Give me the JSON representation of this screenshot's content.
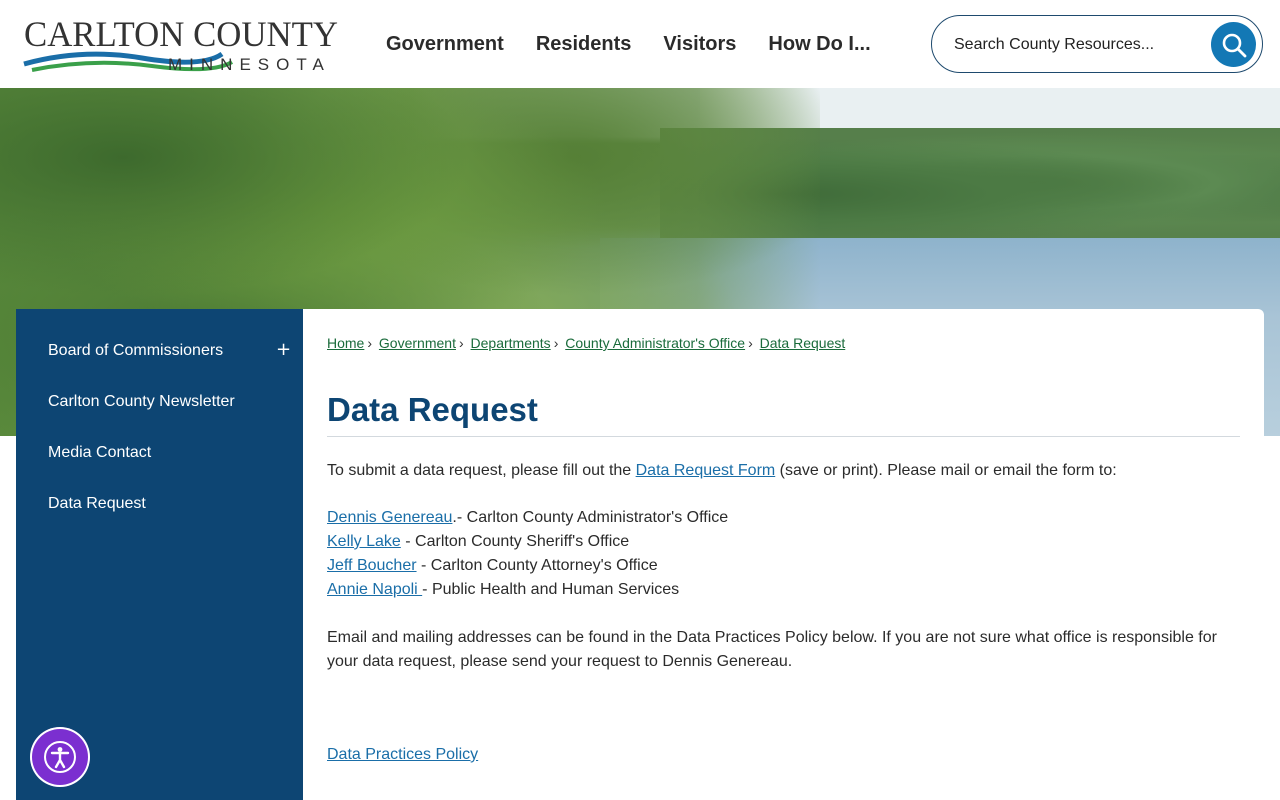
{
  "header": {
    "logo": {
      "line1": "CARLTON COUNTY",
      "line2": "MINNESOTA"
    },
    "nav": [
      {
        "label": "Government"
      },
      {
        "label": "Residents"
      },
      {
        "label": "Visitors"
      },
      {
        "label": "How Do I..."
      }
    ],
    "search": {
      "placeholder": "Search County Resources...",
      "icon": "search-icon"
    }
  },
  "sidebar": {
    "items": [
      {
        "label": "Board of Commissioners",
        "expand": "+"
      },
      {
        "label": "Carlton County Newsletter"
      },
      {
        "label": "Media Contact"
      },
      {
        "label": "Data Request"
      }
    ]
  },
  "breadcrumb": {
    "items": [
      "Home",
      "Government",
      "Departments",
      "County Administrator's Office",
      "Data Request"
    ],
    "separator": "›"
  },
  "main": {
    "title": "Data Request",
    "intro_before": "To submit a data request, please fill out the ",
    "intro_link": "Data Request Form",
    "intro_after": " (save or print). Please mail or email the form to:",
    "contacts": [
      {
        "name": "Dennis Genereau",
        "suffix": ".- Carlton County Administrator's Office"
      },
      {
        "name": "Kelly Lake",
        "suffix": " - Carlton County Sheriff's Office"
      },
      {
        "name": "Jeff Boucher",
        "suffix": " - Carlton County Attorney's Office"
      },
      {
        "name": "Annie Napoli ",
        "suffix": "- Public Health and Human Services"
      }
    ],
    "note_line1": "Email and mailing addresses can be found in the Data Practices Policy below. If you are not sure what office is responsible for",
    "note_line2": "your data request, please send your request to Dennis Genereau.",
    "policy_link": "Data Practices Policy"
  },
  "accessibility": {
    "icon": "accessibility-icon"
  },
  "colors": {
    "brand_blue": "#0d4573",
    "search_button": "#1378b5",
    "link": "#1a6ea8",
    "breadcrumb_link": "#1a6b3b",
    "a11y_purple": "#7b2fd0"
  }
}
